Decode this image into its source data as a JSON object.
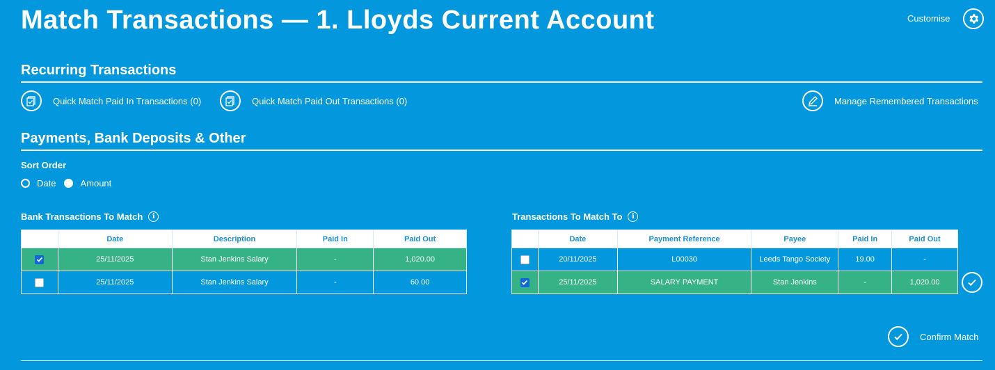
{
  "header": {
    "title": "Match Transactions — 1. Lloyds Current Account",
    "customise_label": "Customise",
    "customise_icon": "gear-icon"
  },
  "recurring": {
    "title": "Recurring Transactions",
    "quick_match_in": "Quick Match Paid In Transactions (0)",
    "quick_match_out": "Quick Match Paid Out Transactions (0)",
    "manage_remembered": "Manage Remembered Transactions"
  },
  "payments": {
    "title": "Payments, Bank Deposits & Other",
    "sort_order_label": "Sort Order",
    "sort_options": [
      {
        "label": "Date",
        "selected": true
      },
      {
        "label": "Amount",
        "selected": false
      }
    ]
  },
  "bank_table": {
    "title": "Bank Transactions To Match",
    "columns": [
      "",
      "Date",
      "Description",
      "Paid In",
      "Paid Out"
    ],
    "rows": [
      {
        "checked": true,
        "date": "25/11/2025",
        "description": "Stan Jenkins Salary",
        "paid_in": "-",
        "paid_out": "1,020.00"
      },
      {
        "checked": false,
        "date": "25/11/2025",
        "description": "Stan Jenkins Salary",
        "paid_in": "-",
        "paid_out": "60.00"
      }
    ]
  },
  "match_table": {
    "title": "Transactions To Match To",
    "columns": [
      "",
      "Date",
      "Payment Reference",
      "Payee",
      "Paid In",
      "Paid Out"
    ],
    "rows": [
      {
        "checked": false,
        "date": "20/11/2025",
        "reference": "L00030",
        "payee": "Leeds Tango Society",
        "paid_in": "19.00",
        "paid_out": "-"
      },
      {
        "checked": true,
        "date": "25/11/2025",
        "reference": "SALARY PAYMENT",
        "payee": "Stan Jenkins",
        "paid_in": "-",
        "paid_out": "1,020.00"
      }
    ]
  },
  "confirm": {
    "label": "Confirm Match"
  },
  "colors": {
    "background": "#0398de",
    "selected_row": "#35b386",
    "header_text": "#1a8fd0",
    "checkbox_checked": "#1167d6"
  }
}
